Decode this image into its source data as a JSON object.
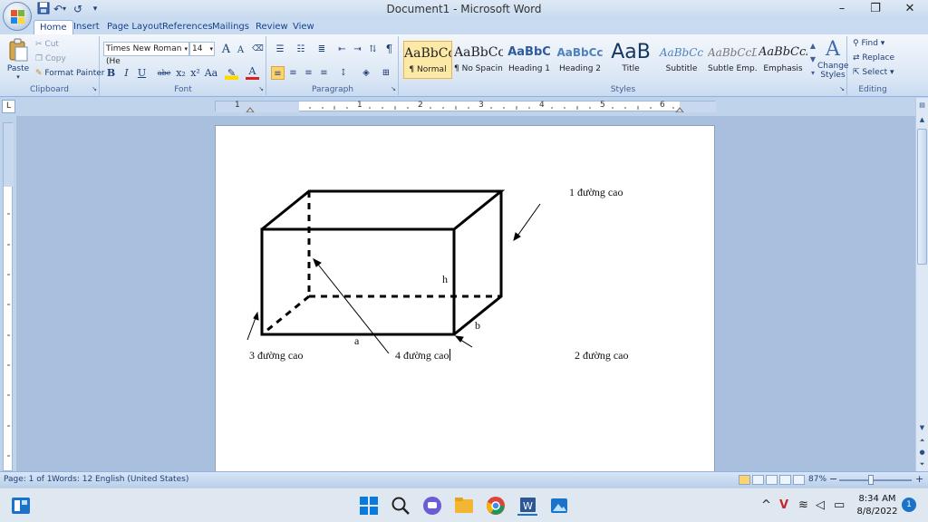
{
  "window": {
    "title": "Document1 - Microsoft Word",
    "minimize": "–",
    "restore": "❐",
    "close": "✕"
  },
  "qat": {
    "save_icon": "save-icon",
    "undo": "↶",
    "redo": "↺",
    "customize": "▾"
  },
  "tabs": [
    "Home",
    "Insert",
    "Page Layout",
    "References",
    "Mailings",
    "Review",
    "View"
  ],
  "clipboard": {
    "paste": "Paste",
    "cut": "Cut",
    "copy": "Copy",
    "format_painter": "Format Painter",
    "label": "Clipboard"
  },
  "font": {
    "name": "Times New Roman (He",
    "size": "14",
    "grow": "A",
    "shrink": "A",
    "bold": "B",
    "italic": "I",
    "underline": "U",
    "strike": "abc",
    "subscript": "x₂",
    "superscript": "x²",
    "change_case": "Aa",
    "font_color": "A",
    "label": "Font"
  },
  "paragraph": {
    "label": "Paragraph",
    "pilcrow": "¶"
  },
  "styles": {
    "label": "Styles",
    "items": [
      {
        "preview": "AaBbCcDc",
        "name": "¶ Normal"
      },
      {
        "preview": "AaBbCcDc",
        "name": "¶ No Spacing"
      },
      {
        "preview": "AaBbC",
        "name": "Heading 1"
      },
      {
        "preview": "AaBbCc",
        "name": "Heading 2"
      },
      {
        "preview": "AaB",
        "name": "Title"
      },
      {
        "preview": "AaBbCc",
        "name": "Subtitle"
      },
      {
        "preview": "AaBbCcDc",
        "name": "Subtle Emp..."
      },
      {
        "preview": "AaBbCcDc",
        "name": "Emphasis"
      }
    ],
    "change_styles": "Change Styles"
  },
  "editing": {
    "label": "Editing",
    "find": "Find",
    "replace": "Replace",
    "select": "Select"
  },
  "ruler": {
    "tab_selector": "L",
    "marks": [
      "1",
      "1",
      "2",
      "3",
      "4",
      "5",
      "6"
    ]
  },
  "document": {
    "labels": {
      "top_right": "1 đường cao",
      "bottom_left": "3 đường cao",
      "bottom_middle": "4 đường cao",
      "bottom_right": "2 đường cao",
      "h": "h",
      "a": "a",
      "b": "b"
    }
  },
  "status": {
    "page": "Page: 1 of 1",
    "words": "Words: 12",
    "language": "English (United States)",
    "zoom": "87%",
    "zoom_out": "−",
    "zoom_in": "+"
  },
  "taskbar": {
    "time": "8:34 AM",
    "date": "8/8/2022",
    "notifications": "1"
  },
  "colors": {
    "accent": "#15428b",
    "ribbon": "#dbe7f5",
    "page": "#ffffff",
    "workspace": "#a8c0dd"
  }
}
